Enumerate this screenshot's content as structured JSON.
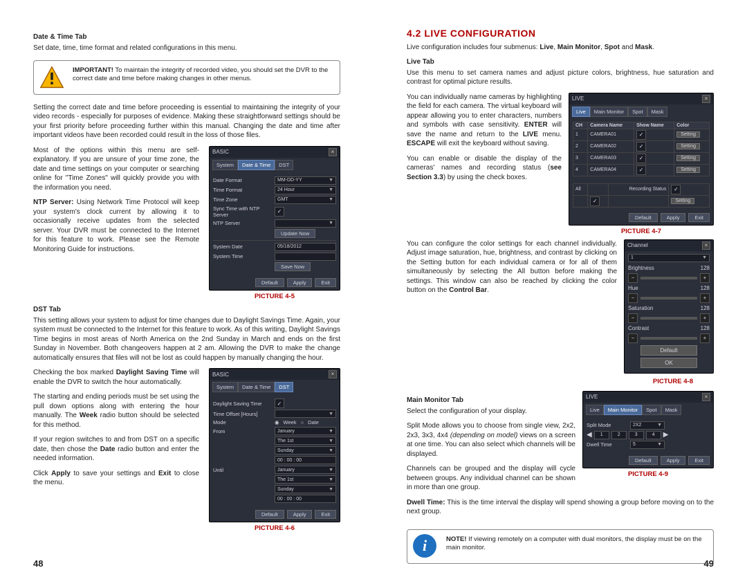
{
  "left": {
    "h_date_time": "Date & Time Tab",
    "p_intro": "Set date, time, time format and related configurations in this menu.",
    "important_label": "IMPORTANT!",
    "important_text": " To maintain the integrity of recorded video, you should set the DVR to the correct date and time before making changes in other menus.",
    "p_after_important": "Setting the correct date and time before proceeding is essential to maintaining the integrity of your video records - especially for purposes of evidence. Making these straightforward settings should be your first priority before proceeding further within this manual. Changing the date and time after important videos have been recorded could result in the loss of those files.",
    "p_most_options": "Most of the options within this menu are self-explanatory. If you are unsure of your time zone, the date and time settings on your computer or searching online for \"Time Zones\" will quickly provide you with the information you need.",
    "ntp_label": "NTP Server:",
    "ntp_text": " Using Network Time Protocol will keep your system's clock current by allowing it to occasionally receive updates from the selected server. Your DVR must be connected to the Internet for this feature to work. Please see the Remote Monitoring Guide for instructions.",
    "pic45": "PICTURE 4-5",
    "h_dst": "DST Tab",
    "p_dst1": "This setting allows your system to adjust for time changes due to Daylight Savings Time. Again, your system must be connected to the Internet for this feature to work. As of this writing, Daylight Savings Time begins in most areas of North America on the 2nd Sunday in March and ends on the first Sunday in November. Both changeovers happen at 2 am. Allowing the DVR to make the change automatically ensures that files will not be lost as could happen by manually changing the hour.",
    "p_dst2a": "Checking the box marked ",
    "p_dst2b": "Daylight Saving Time",
    "p_dst2c": " will enable the DVR to switch the hour automatically.",
    "p_dst3a": "The starting and ending periods must be set using the pull down options along with entering the hour manually. The ",
    "p_dst3b": "Week",
    "p_dst3c": " radio button should be selected for this method.",
    "p_dst4a": "If your region switches to and from DST on a specific date, then chose the ",
    "p_dst4b": "Date",
    "p_dst4c": " radio button and enter the needed information.",
    "p_dst5a": "Click ",
    "p_dst5b": "Apply",
    "p_dst5c": " to save your settings and ",
    "p_dst5d": "Exit",
    "p_dst5e": " to close the menu.",
    "pic46": "PICTURE 4-6",
    "shot45": {
      "title": "BASIC",
      "tabs": [
        "System",
        "Date & Time",
        "DST"
      ],
      "rows": [
        {
          "lbl": "Date Format",
          "val": "MM-DD-YY"
        },
        {
          "lbl": "Time Format",
          "val": "24 Hour"
        },
        {
          "lbl": "Time Zone",
          "val": "GMT"
        },
        {
          "lbl": "Sync Time with NTP Server",
          "chk": true
        },
        {
          "lbl": "NTP Server",
          "val": ""
        }
      ],
      "update_btn": "Update Now",
      "rows2": [
        {
          "lbl": "System Date",
          "val": "05/18/2012"
        },
        {
          "lbl": "System Time",
          "val": ""
        }
      ],
      "save_btn": "Save Now",
      "btns": [
        "Default",
        "Apply",
        "Exit"
      ]
    },
    "shot46": {
      "title": "BASIC",
      "tabs": [
        "System",
        "Date & Time",
        "DST"
      ],
      "rows": [
        {
          "lbl": "Daylight Saving Time",
          "chk": true
        },
        {
          "lbl": "Time Offset [Hours]",
          "val": ""
        },
        {
          "lbl": "Mode",
          "radio": true,
          "r1": "Week",
          "r2": "Date"
        },
        {
          "lbl": "From",
          "val": "January"
        },
        {
          "lbl": "",
          "val": "The 1st"
        },
        {
          "lbl": "",
          "val": "Sunday"
        },
        {
          "lbl": "",
          "val": "00 : 00 : 00"
        },
        {
          "lbl": "Until",
          "val": "January"
        },
        {
          "lbl": "",
          "val": "The 1st"
        },
        {
          "lbl": "",
          "val": "Sunday"
        },
        {
          "lbl": "",
          "val": "00 : 00 : 00"
        }
      ],
      "btns": [
        "Default",
        "Apply",
        "Exit"
      ]
    },
    "pagenum": "48"
  },
  "right": {
    "h_section": "4.2 LIVE CONFIGURATION",
    "p_intro_a": "Live configuration includes four submenus: ",
    "p_intro_b": "Live",
    "p_intro_c": ", ",
    "p_intro_d": "Main Monitor",
    "p_intro_e": ", ",
    "p_intro_f": "Spot",
    "p_intro_g": " and ",
    "p_intro_h": "Mask",
    "p_intro_i": ".",
    "h_live": "Live Tab",
    "p_live1": "Use this menu to set camera names and adjust picture colors, brightness, hue saturation and contrast for optimal picture results.",
    "p_live2a": "You can individually name cameras by highlighting the field for each camera. The virtual keyboard will appear allowing you to enter characters, numbers and symbols with case sensitivity. ",
    "p_live2b": "ENTER",
    "p_live2c": " will save the name and return to the ",
    "p_live2d": "LIVE",
    "p_live2e": " menu. ",
    "p_live2f": "ESCAPE",
    "p_live2g": " will exit the keyboard without saving.",
    "p_live3a": "You can enable or disable the display of the cameras' names and recording status (",
    "p_live3b": "see Section 3.3",
    "p_live3c": ") by using the check boxes.",
    "pic47": "PICTURE 4-7",
    "p_color_a": "You can configure the color settings for each channel individually. Adjust image saturation, hue, brightness, and contrast by clicking on the Setting button for each individual camera or for all of them simultaneously by selecting the All button before making the settings. This window can also be reached by clicking the color button on the ",
    "p_color_b": "Control Bar",
    "p_color_c": ".",
    "pic48": "PICTURE 4-8",
    "h_main": "Main Monitor Tab",
    "p_main1": "Select the configuration of your display.",
    "p_main2a": "Split Mode allows you to choose from single view, 2x2, 2x3, 3x3, 4x4 ",
    "p_main2b": "(depending on model)",
    "p_main2c": " views on a screen at one time. You can also select which channels will be displayed.",
    "p_main3": "Channels can be grouped and the display will cycle between groups. Any individual channel can be shown in more than one group.",
    "p_dwell_a": "Dwell Time:",
    "p_dwell_b": " This is the time interval the display will spend showing a group before moving on to the next group.",
    "pic49": "PICTURE 4-9",
    "note_label": "NOTE!",
    "note_text": " If viewing remotely on a computer with dual monitors, the display must be on the main monitor.",
    "shot47": {
      "title": "LIVE",
      "tabs": [
        "Live",
        "Main Monitor",
        "Spot",
        "Mask"
      ],
      "cols": [
        "CH",
        "Camera Name",
        "Show Name",
        "Color"
      ],
      "rows": [
        {
          "ch": "1",
          "name": "CAMERA01",
          "show": true
        },
        {
          "ch": "2",
          "name": "CAMERA02",
          "show": true
        },
        {
          "ch": "3",
          "name": "CAMERA03",
          "show": true
        },
        {
          "ch": "4",
          "name": "CAMERA04",
          "show": true
        }
      ],
      "all_label": "All",
      "rec_label": "Recording Status",
      "setting": "Setting",
      "btns": [
        "Default",
        "Apply",
        "Exit"
      ]
    },
    "shot48": {
      "title": "Channel",
      "channel_val": "1",
      "sliders": [
        {
          "lbl": "Brightness",
          "val": "128"
        },
        {
          "lbl": "Hue",
          "val": "128"
        },
        {
          "lbl": "Saturation",
          "val": "128"
        },
        {
          "lbl": "Contrast",
          "val": "128"
        }
      ],
      "default_btn": "Default",
      "ok_btn": "OK"
    },
    "shot49": {
      "title": "LIVE",
      "tabs": [
        "Live",
        "Main Monitor",
        "Spot",
        "Mask"
      ],
      "split_label": "Split Mode",
      "split_val": "2X2",
      "dwell_label": "Dwell Time",
      "dwell_val": "5",
      "btns": [
        "Default",
        "Apply",
        "Exit"
      ]
    },
    "pagenum": "49"
  }
}
